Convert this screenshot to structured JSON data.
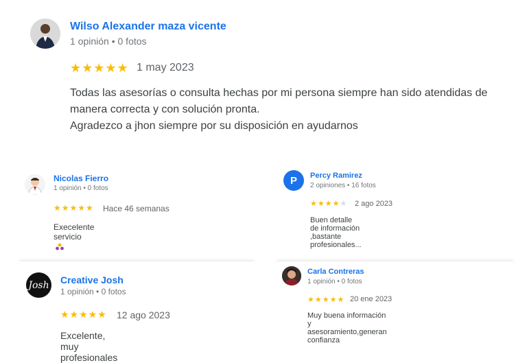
{
  "colors": {
    "name": "#1a73e8",
    "star": "#fbbc04",
    "star_empty": "#dadce0",
    "avatar_letter_bg": "#1a73e8"
  },
  "reviews": [
    {
      "name": "Wilso Alexander maza vicente",
      "meta": "1 opinión • 0 fotos",
      "rating": 5,
      "stars": "★★★★★",
      "date": "1 may 2023",
      "text_line1": "Todas las asesorías o consulta hechas por mi persona siempre han sido atendidas de",
      "text_line2": "manera correcta y con solución pronta.",
      "text_line3": "Agradezco a jhon siempre por su disposición en ayudarnos",
      "avatar_icon": "person-photo-icon"
    },
    {
      "name": "Nicolas Fierro",
      "meta": "1 opinión • 0 fotos",
      "rating": 5,
      "stars": "★★★★★",
      "date": "Hace 46 semanas",
      "text": "Execelente servicio",
      "avatar_icon": "cartoon-avatar-icon",
      "emoji": "people-emoji-icon"
    },
    {
      "name": "Percy Ramirez",
      "meta": "2 opiniones • 16 fotos",
      "rating": 4,
      "stars_on": "★★★★",
      "stars_off": "★",
      "date": "2 ago 2023",
      "text": "Buen detalle de información ,bastante profesionales...",
      "avatar_letter": "P"
    },
    {
      "name": "Creative Josh",
      "meta": "1 opinión • 0 fotos",
      "rating": 5,
      "stars": "★★★★★",
      "date": "12 ago 2023",
      "text": "Excelente, muy profesionales",
      "avatar_text": "Josh"
    },
    {
      "name": "Carla Contreras",
      "meta": "1 opinión • 0 fotos",
      "rating": 5,
      "stars": "★★★★★",
      "date": "20 ene 2023",
      "text": "Muy buena información y asesoramiento,generan confianza",
      "avatar_icon": "person-photo-icon"
    }
  ]
}
